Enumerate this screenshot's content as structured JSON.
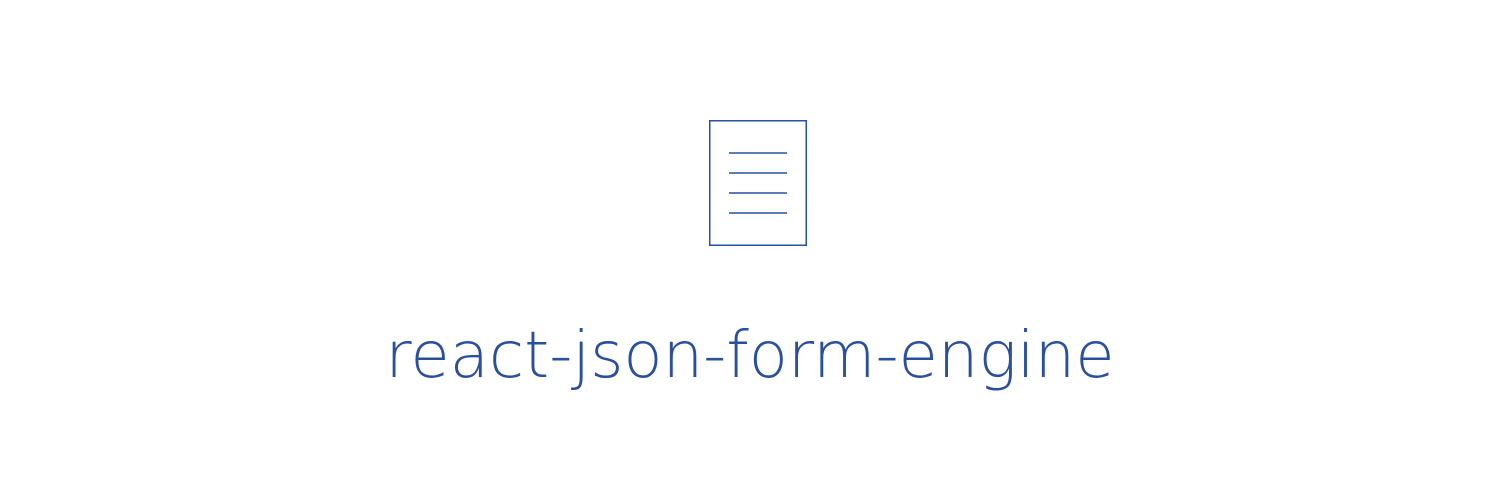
{
  "brand": {
    "name": "react-json-form-engine",
    "icon": "document-icon",
    "color": "#2a4f9c",
    "background": "#ffffff"
  }
}
